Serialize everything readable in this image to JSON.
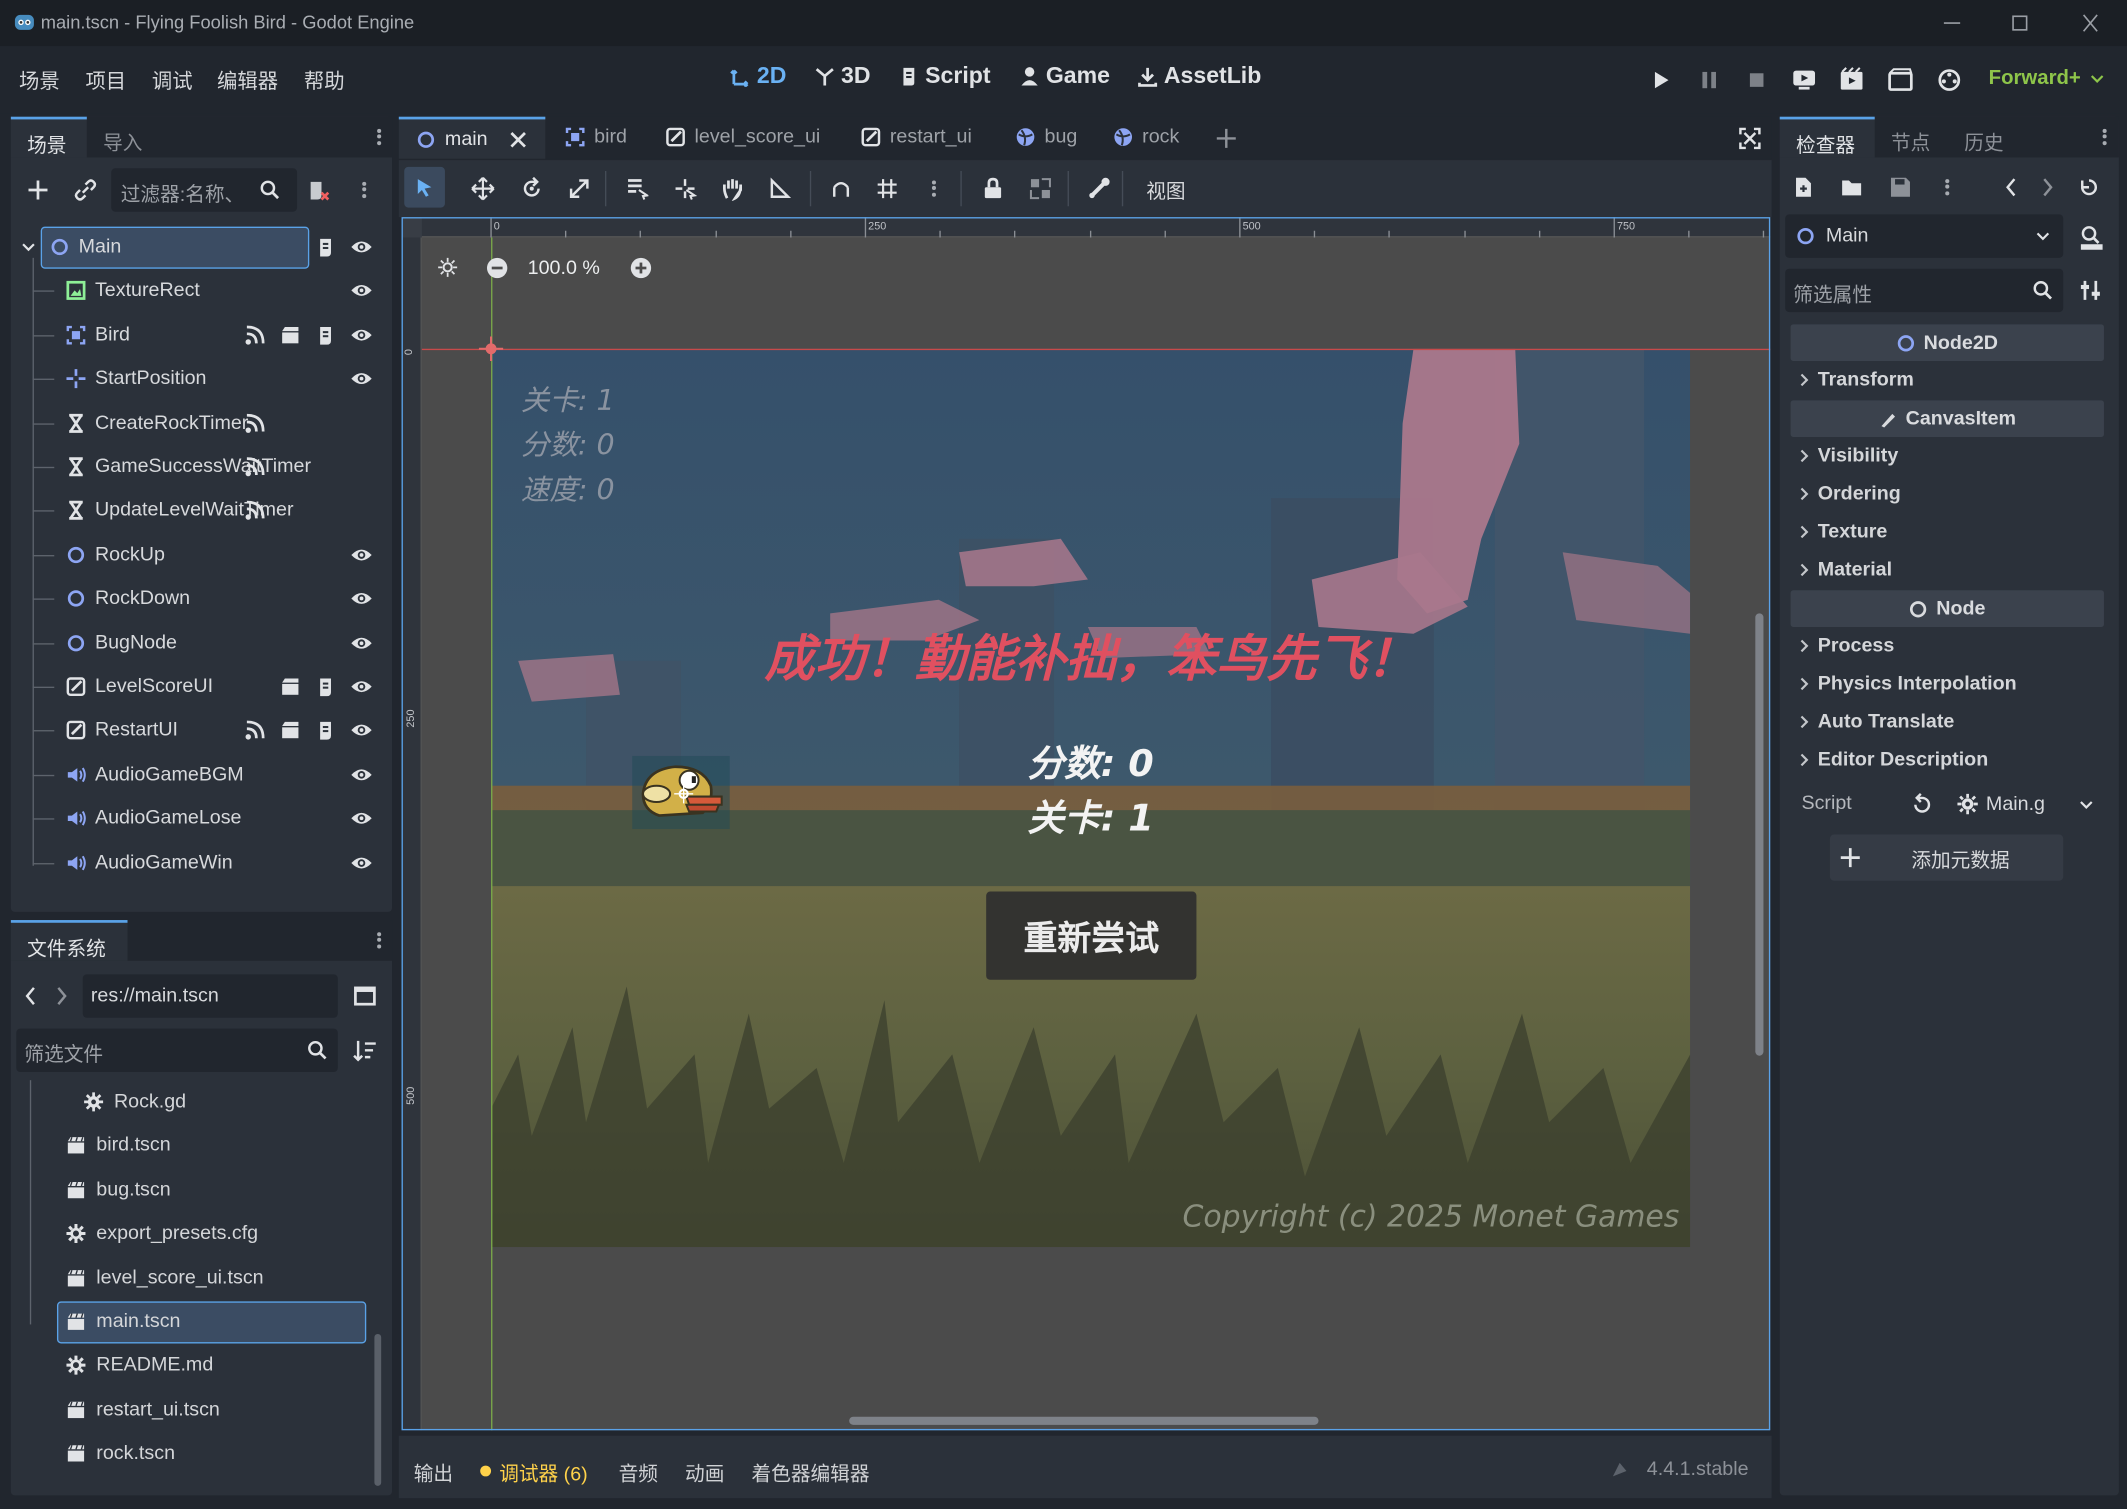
{
  "window": {
    "title": "main.tscn - Flying Foolish Bird - Godot Engine"
  },
  "menu": [
    "场景",
    "项目",
    "调试",
    "编辑器",
    "帮助"
  ],
  "modes": [
    "2D",
    "3D",
    "Script",
    "Game",
    "AssetLib"
  ],
  "renderer": "Forward+",
  "scene_dock": {
    "tabs": [
      "场景",
      "导入"
    ],
    "filter_placeholder": "过滤器:名称、",
    "nodes": [
      {
        "name": "Main",
        "icon": "node2d-icon",
        "depth": 0,
        "selected": true
      },
      {
        "name": "TextureRect",
        "icon": "texture-rect-icon",
        "depth": 1
      },
      {
        "name": "Bird",
        "icon": "character-body-icon",
        "depth": 1
      },
      {
        "name": "StartPosition",
        "icon": "marker2d-icon",
        "depth": 1
      },
      {
        "name": "CreateRockTimer",
        "icon": "timer-icon",
        "depth": 1
      },
      {
        "name": "GameSuccessWaitTimer",
        "icon": "timer-icon",
        "depth": 1
      },
      {
        "name": "UpdateLevelWaitTimer",
        "icon": "timer-icon",
        "depth": 1
      },
      {
        "name": "RockUp",
        "icon": "node2d-icon",
        "depth": 1
      },
      {
        "name": "RockDown",
        "icon": "node2d-icon",
        "depth": 1
      },
      {
        "name": "BugNode",
        "icon": "node2d-icon",
        "depth": 1
      },
      {
        "name": "LevelScoreUI",
        "icon": "control-icon",
        "depth": 1
      },
      {
        "name": "RestartUI",
        "icon": "control-icon",
        "depth": 1
      },
      {
        "name": "AudioGameBGM",
        "icon": "audio-icon",
        "depth": 1
      },
      {
        "name": "AudioGameLose",
        "icon": "audio-icon",
        "depth": 1
      },
      {
        "name": "AudioGameWin",
        "icon": "audio-icon",
        "depth": 1
      }
    ]
  },
  "filesystem": {
    "tab": "文件系统",
    "path": "res://main.tscn",
    "filter_placeholder": "筛选文件",
    "files": [
      {
        "name": "Rock.gd",
        "icon": "gear-icon",
        "indent": 1
      },
      {
        "name": "bird.tscn",
        "icon": "clapper-icon"
      },
      {
        "name": "bug.tscn",
        "icon": "clapper-icon"
      },
      {
        "name": "export_presets.cfg",
        "icon": "cog-file-icon"
      },
      {
        "name": "level_score_ui.tscn",
        "icon": "clapper-icon"
      },
      {
        "name": "main.tscn",
        "icon": "clapper-icon",
        "selected": true
      },
      {
        "name": "README.md",
        "icon": "cog-file-icon"
      },
      {
        "name": "restart_ui.tscn",
        "icon": "clapper-icon"
      },
      {
        "name": "rock.tscn",
        "icon": "clapper-icon"
      }
    ]
  },
  "editor_tabs": [
    "main",
    "bird",
    "level_score_ui",
    "restart_ui",
    "bug",
    "rock"
  ],
  "toolbar": {
    "view_menu": "视图"
  },
  "viewport": {
    "zoom": "100.0 %",
    "ruler_marks": [
      "0",
      "250",
      "500",
      "750"
    ],
    "ruler_v_marks": [
      "0",
      "250",
      "500"
    ],
    "game": {
      "hud": [
        "关卡: 1",
        "分数: 0",
        "速度: 0"
      ],
      "banner": "成功！勤能补拙，笨鸟先飞！",
      "score": "分数: 0",
      "level": "关卡: 1",
      "retry_button": "重新尝试",
      "copyright": "Copyright (c) 2025 Monet Games"
    }
  },
  "inspector": {
    "tabs": [
      "检查器",
      "节点",
      "历史"
    ],
    "object": "Main",
    "filter_placeholder": "筛选属性",
    "sections": [
      {
        "kind": "header",
        "label": "Node2D",
        "icon": "circle-icon"
      },
      {
        "kind": "prop",
        "label": "Transform"
      },
      {
        "kind": "header",
        "label": "CanvasItem",
        "icon": "brush-icon"
      },
      {
        "kind": "prop",
        "label": "Visibility"
      },
      {
        "kind": "prop",
        "label": "Ordering"
      },
      {
        "kind": "prop",
        "label": "Texture"
      },
      {
        "kind": "prop",
        "label": "Material"
      },
      {
        "kind": "header",
        "label": "Node",
        "icon": "circle-icon"
      },
      {
        "kind": "prop",
        "label": "Process"
      },
      {
        "kind": "prop",
        "label": "Physics Interpolation"
      },
      {
        "kind": "prop",
        "label": "Auto Translate"
      },
      {
        "kind": "prop",
        "label": "Editor Description"
      }
    ],
    "script_label": "Script",
    "script_value": "Main.g",
    "add_metadata": "添加元数据"
  },
  "bottom": {
    "tabs": [
      "输出",
      "调试器 (6)",
      "音频",
      "动画",
      "着色器编辑器"
    ],
    "version": "4.4.1.stable"
  },
  "colors": {
    "accent": "#5aa2e8",
    "warning": "#ffd24a",
    "banner": "#e05060"
  }
}
